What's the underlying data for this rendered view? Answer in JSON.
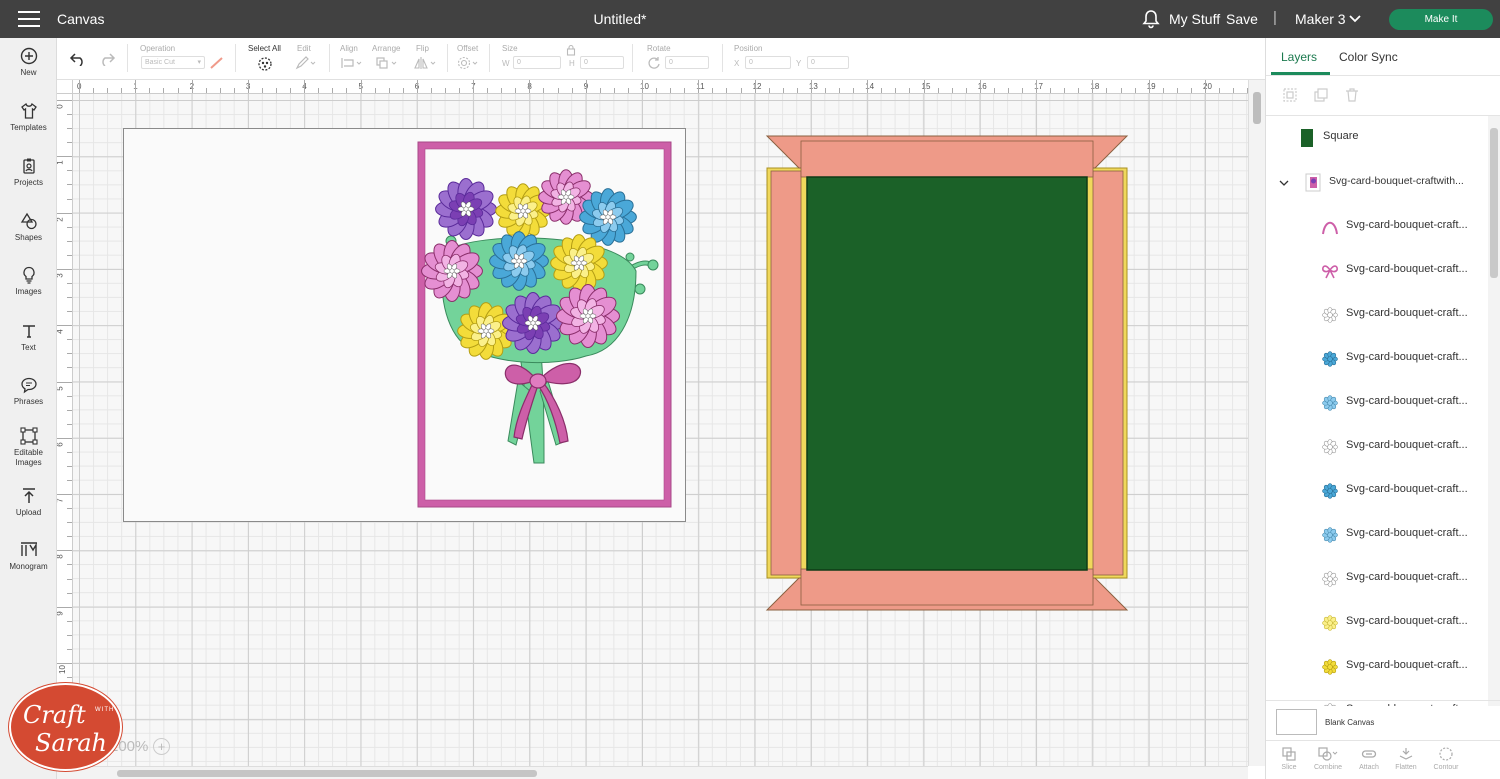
{
  "topbar": {
    "app_name": "Canvas",
    "document_title": "Untitled*",
    "my_stuff": "My Stuff",
    "save": "Save",
    "separator": "|",
    "machine": "Maker 3",
    "make_it": "Make It"
  },
  "leftbar": {
    "items": [
      {
        "label": "New",
        "icon": "plus-circle-icon"
      },
      {
        "label": "Templates",
        "icon": "tshirt-icon"
      },
      {
        "label": "Projects",
        "icon": "clipboard-icon"
      },
      {
        "label": "Shapes",
        "icon": "shapes-icon"
      },
      {
        "label": "Images",
        "icon": "lightbulb-icon"
      },
      {
        "label": "Text",
        "icon": "text-t-icon"
      },
      {
        "label": "Phrases",
        "icon": "speech-bubble-icon"
      },
      {
        "label": "Editable Images",
        "icon": "edit-image-icon"
      },
      {
        "label": "Upload",
        "icon": "upload-icon"
      },
      {
        "label": "Monogram",
        "icon": "monogram-icon"
      }
    ]
  },
  "toolbar": {
    "operation_label": "Operation",
    "operation_value": "Basic Cut",
    "select_all_label": "Select All",
    "edit_label": "Edit",
    "align_label": "Align",
    "arrange_label": "Arrange",
    "flip_label": "Flip",
    "offset_label": "Offset",
    "size_label": "Size",
    "w_label": "W",
    "w_value": "0",
    "h_label": "H",
    "h_value": "0",
    "rotate_label": "Rotate",
    "rotate_value": "0",
    "position_label": "Position",
    "x_label": "X",
    "x_value": "0",
    "y_label": "Y",
    "y_value": "0"
  },
  "rulers": {
    "horizontal": [
      "0",
      "1",
      "2",
      "3",
      "4",
      "5",
      "6",
      "7",
      "8",
      "9",
      "10",
      "11",
      "12",
      "13",
      "14",
      "15",
      "16",
      "17",
      "18",
      "19",
      "20"
    ],
    "vertical": [
      "0",
      "1",
      "2",
      "3",
      "4",
      "5",
      "6",
      "7",
      "8",
      "9",
      "10"
    ]
  },
  "canvas": {
    "zoom": "100%",
    "zoom_plus": "+",
    "colors": {
      "card_frame": "#cd5fa8",
      "tray_pink": "#ee9a88",
      "tray_outline": "#e8cf3a",
      "tray_inner": "#1b6128"
    }
  },
  "watermark": {
    "line1": "Craft",
    "small": "WITH",
    "line2": "Sarah"
  },
  "layers_panel": {
    "tab_layers": "Layers",
    "tab_color_sync": "Color Sync",
    "layers": [
      {
        "name": "Square",
        "thumb": "green-square"
      },
      {
        "name": "Svg-card-bouquet-craftwith...",
        "thumb": "bouquet-group",
        "expanded": true
      },
      {
        "name": "Svg-card-bouquet-craft...",
        "thumb": "pink-arc"
      },
      {
        "name": "Svg-card-bouquet-craft...",
        "thumb": "pink-bow"
      },
      {
        "name": "Svg-card-bouquet-craft...",
        "thumb": "white-flower"
      },
      {
        "name": "Svg-card-bouquet-craft...",
        "thumb": "blue-flower"
      },
      {
        "name": "Svg-card-bouquet-craft...",
        "thumb": "light-blue-flower"
      },
      {
        "name": "Svg-card-bouquet-craft...",
        "thumb": "white-flower"
      },
      {
        "name": "Svg-card-bouquet-craft...",
        "thumb": "blue-flower"
      },
      {
        "name": "Svg-card-bouquet-craft...",
        "thumb": "light-blue-flower"
      },
      {
        "name": "Svg-card-bouquet-craft...",
        "thumb": "white-flower"
      },
      {
        "name": "Svg-card-bouquet-craft...",
        "thumb": "pale-yellow-flower"
      },
      {
        "name": "Svg-card-bouquet-craft...",
        "thumb": "yellow-flower"
      },
      {
        "name": "Svg-card-bouquet-craft...",
        "thumb": "white-flower"
      }
    ],
    "blank_canvas": "Blank Canvas",
    "bottom_tools": [
      "Slice",
      "Combine",
      "Attach",
      "Flatten",
      "Contour"
    ]
  }
}
